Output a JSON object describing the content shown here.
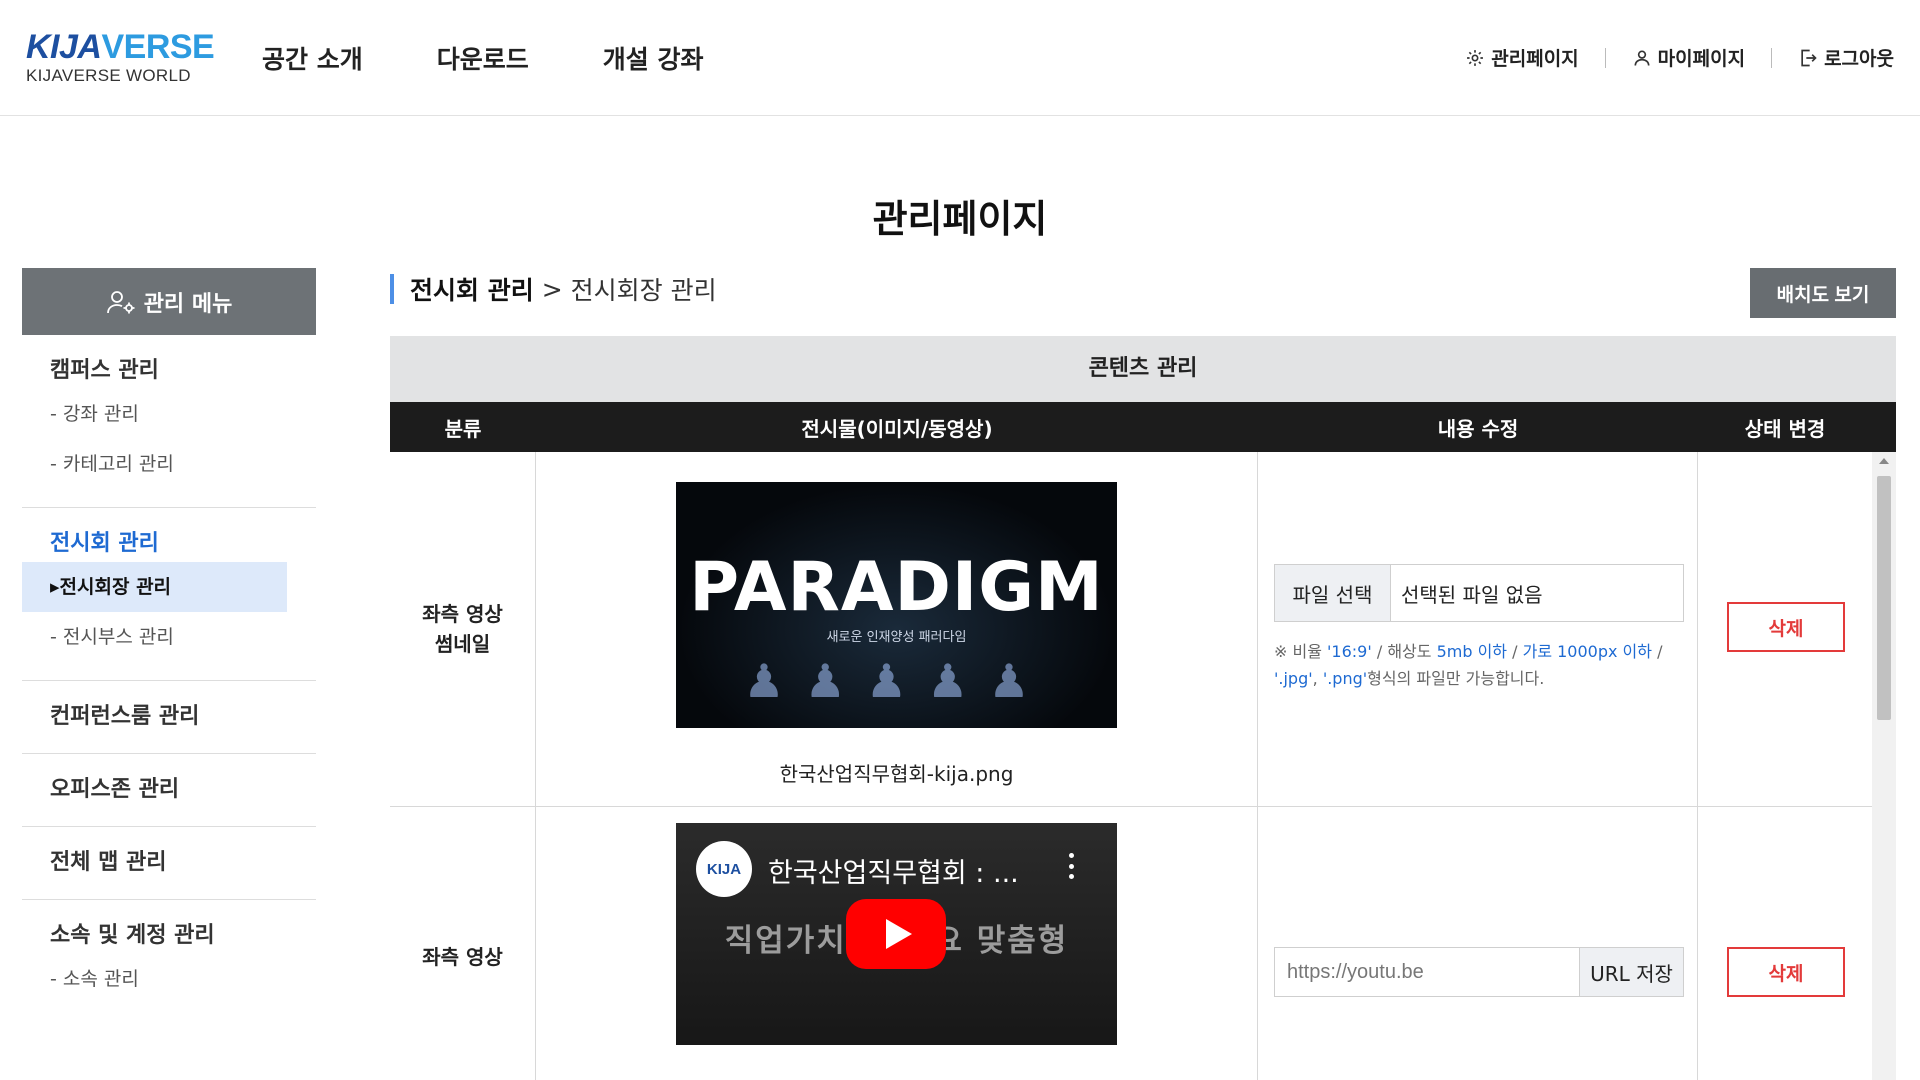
{
  "brand": {
    "logo_kija": "KIJA",
    "logo_verse": "VERSE",
    "logo_sub": "KIJAVERSE WORLD"
  },
  "gnb": [
    "공간 소개",
    "다운로드",
    "개설 강좌"
  ],
  "util": {
    "admin": "관리페이지",
    "mypage": "마이페이지",
    "logout": "로그아웃"
  },
  "page_title": "관리페이지",
  "sidebar": {
    "head": "관리 메뉴",
    "campus": {
      "title": "캠퍼스 관리",
      "subs": [
        "- 강좌 관리",
        "- 카테고리 관리"
      ]
    },
    "exhibit": {
      "title": "전시회 관리",
      "subs": [
        "▸전시회장 관리",
        "- 전시부스 관리"
      ]
    },
    "conference": "컨퍼런스룸 관리",
    "office": "오피스존 관리",
    "map": "전체 맵 관리",
    "account": {
      "title": "소속 및 계정 관리",
      "subs": [
        "- 소속 관리"
      ]
    }
  },
  "breadcrumb": {
    "level1": "전시회 관리",
    "sep": ">",
    "level2": "전시회장 관리"
  },
  "layout_button": "배치도 보기",
  "table": {
    "caption": "콘텐츠 관리",
    "headers": [
      "분류",
      "전시물(이미지/동영상)",
      "내용 수정",
      "상태 변경"
    ],
    "rows": [
      {
        "category_line1": "좌측 영상",
        "category_line2": "썸네일",
        "thumb_title": "PARADIGM",
        "thumb_sub": "새로운 인재양성 패러다임",
        "file_name": "한국산업직무협회-kija.png",
        "file_button": "파일 선택",
        "file_status": "선택된 파일 없음",
        "notice_prefix": "※ 비율 ",
        "notice_ratio": "'16:9'",
        "notice_res_label": " / 해상도 ",
        "notice_res": "5mb 이하",
        "notice_s1": " / ",
        "notice_width": "가로 1000px 이하",
        "notice_s2": " / ",
        "notice_jpg": "'.jpg'",
        "notice_comma": ", ",
        "notice_png": "'.png'",
        "notice_suffix": "형식의 파일만 가능합니다.",
        "delete": "삭제"
      },
      {
        "category": "좌측 영상",
        "video_logo": "KIJA",
        "video_title": "한국산업직무협회 : ...",
        "video_bg_text": "직업가치 보 수요 맞춤형",
        "url_placeholder": "https://youtu.be",
        "url_button": "URL 저장",
        "delete": "삭제"
      }
    ]
  }
}
